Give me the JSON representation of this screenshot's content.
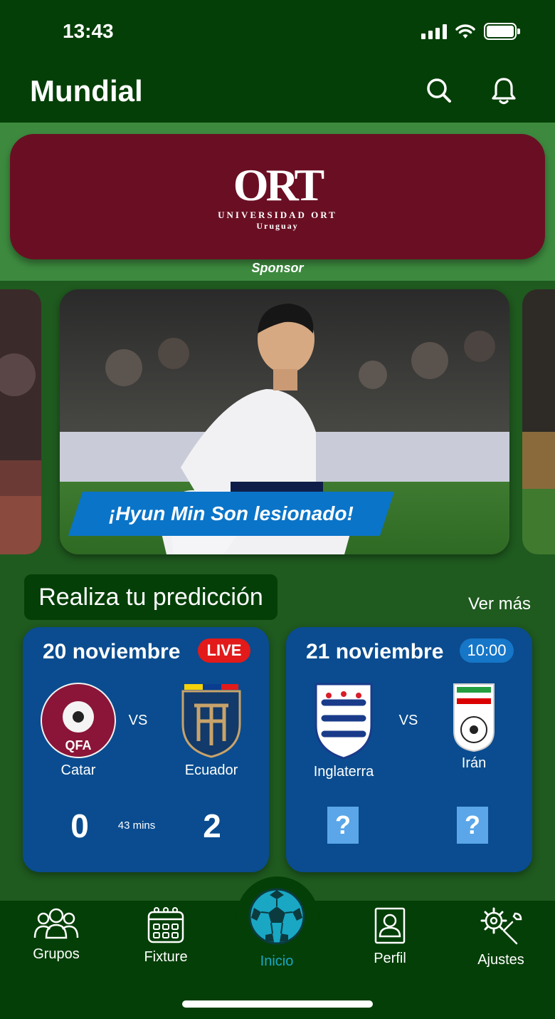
{
  "status_bar": {
    "time": "13:43"
  },
  "header": {
    "title": "Mundial"
  },
  "sponsor": {
    "logo_text": "ORT",
    "logo_line1": "UNIVERSIDAD ORT",
    "logo_line2": "Uruguay",
    "label": "Sponsor"
  },
  "news": {
    "caption": "¡Hyun Min Son lesionado!"
  },
  "predictions": {
    "title": "Realiza tu predicción",
    "see_more": "Ver más",
    "matches": [
      {
        "date": "20 noviembre",
        "badge": "LIVE",
        "home": "Catar",
        "away": "Ecuador",
        "vs": "VS",
        "home_score": "0",
        "away_score": "2",
        "elapsed": "43 mins"
      },
      {
        "date": "21 noviembre",
        "badge": "10:00",
        "home": "Inglaterra",
        "away": "Irán",
        "vs": "VS",
        "home_score": "?",
        "away_score": "?"
      }
    ]
  },
  "nav": {
    "items": [
      {
        "label": "Grupos",
        "icon": "users-icon"
      },
      {
        "label": "Fixture",
        "icon": "calendar-icon"
      },
      {
        "label": "Inicio",
        "icon": "soccer-ball-icon",
        "active": true
      },
      {
        "label": "Perfil",
        "icon": "profile-icon"
      },
      {
        "label": "Ajustes",
        "icon": "settings-icon"
      }
    ]
  },
  "colors": {
    "header_bg": "#043f07",
    "page_bg": "#1f5a1f",
    "card_blue": "#0a4c8f",
    "sponsor_bg": "#6a0f23",
    "live_red": "#e21a1a",
    "active_cyan": "#19a7c4"
  }
}
